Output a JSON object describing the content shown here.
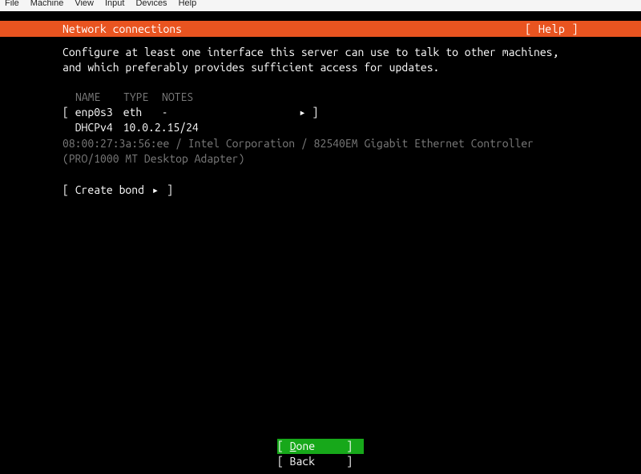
{
  "host_menu": {
    "items": [
      "File",
      "Machine",
      "View",
      "Input",
      "Devices",
      "Help"
    ]
  },
  "titlebar": {
    "title": "Network connections",
    "help": "[ Help ]"
  },
  "instructions": {
    "line1": "Configure at least one interface this server can use to talk to other machines,",
    "line2": "and which preferably provides sufficient access for updates."
  },
  "columns": {
    "name": "NAME",
    "type": "TYPE",
    "notes": "NOTES"
  },
  "interface": {
    "open": "[",
    "name": "enp0s3",
    "type": "eth",
    "notes": "-",
    "arrow": "▸",
    "close": "]",
    "dhcp_label": "DHCPv4",
    "dhcp_value": "10.0.2.15/24",
    "hwline1": "08:00:27:3a:56:ee / Intel Corporation / 82540EM Gigabit Ethernet Controller",
    "hwline2": "(PRO/1000 MT Desktop Adapter)"
  },
  "create_bond": {
    "open": "[",
    "label": "Create bond",
    "arrow": "▸",
    "close": "]"
  },
  "footer": {
    "done_open": "[ ",
    "done_label_first": "D",
    "done_label_rest": "one",
    "done_close": "     ]",
    "back_open": "[ ",
    "back_label": "Back",
    "back_close": "     ]"
  }
}
